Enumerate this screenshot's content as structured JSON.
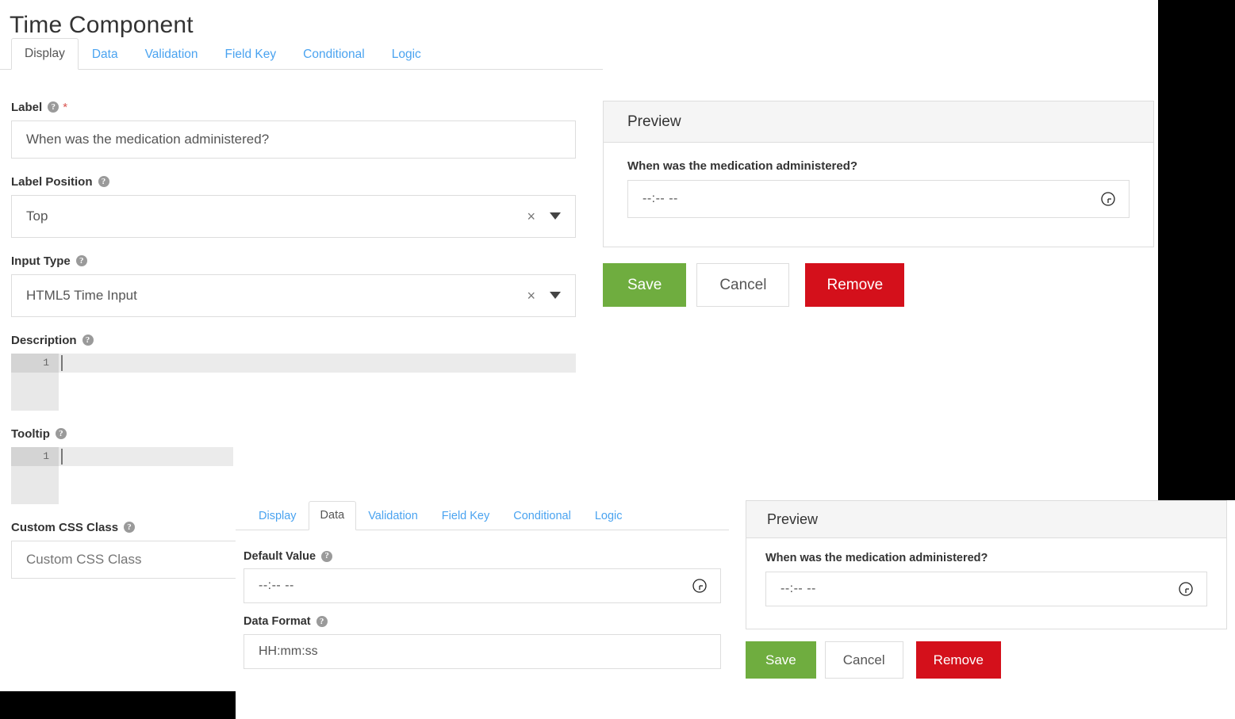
{
  "dialog1": {
    "title": "Time Component",
    "tabs": [
      {
        "label": "Display",
        "active": true
      },
      {
        "label": "Data",
        "active": false
      },
      {
        "label": "Validation",
        "active": false
      },
      {
        "label": "Field Key",
        "active": false
      },
      {
        "label": "Conditional",
        "active": false
      },
      {
        "label": "Logic",
        "active": false
      }
    ],
    "fields": {
      "label": {
        "label": "Label",
        "required_marker": "*",
        "help": "?",
        "value": "When was the medication administered?"
      },
      "label_position": {
        "label": "Label Position",
        "help": "?",
        "value": "Top",
        "clear": "×"
      },
      "input_type": {
        "label": "Input Type",
        "help": "?",
        "value": "HTML5 Time Input",
        "clear": "×"
      },
      "description": {
        "label": "Description",
        "help": "?",
        "line_number": "1",
        "value": ""
      },
      "tooltip": {
        "label": "Tooltip",
        "help": "?",
        "line_number": "1",
        "value": ""
      },
      "custom_css_class": {
        "label": "Custom CSS Class",
        "help": "?",
        "placeholder": "Custom CSS Class",
        "value": ""
      }
    },
    "preview": {
      "title": "Preview",
      "question_label": "When was the medication administered?",
      "time_value": "--:-- --"
    },
    "buttons": {
      "save": "Save",
      "cancel": "Cancel",
      "remove": "Remove"
    }
  },
  "dialog2": {
    "tabs": [
      {
        "label": "Display",
        "active": false
      },
      {
        "label": "Data",
        "active": true
      },
      {
        "label": "Validation",
        "active": false
      },
      {
        "label": "Field Key",
        "active": false
      },
      {
        "label": "Conditional",
        "active": false
      },
      {
        "label": "Logic",
        "active": false
      }
    ],
    "fields": {
      "default_value": {
        "label": "Default Value",
        "help": "?",
        "value": "--:-- --"
      },
      "data_format": {
        "label": "Data Format",
        "help": "?",
        "value": "HH:mm:ss"
      }
    },
    "preview": {
      "title": "Preview",
      "question_label": "When was the medication administered?",
      "time_value": "--:-- --"
    },
    "buttons": {
      "save": "Save",
      "cancel": "Cancel",
      "remove": "Remove"
    }
  },
  "colors": {
    "save_green": "#6fad3f",
    "remove_red": "#d4101b",
    "link_blue": "#4aa3f0",
    "required_red": "#d9534f",
    "border_gray": "#dddddd",
    "panel_head_gray": "#f5f5f5"
  }
}
